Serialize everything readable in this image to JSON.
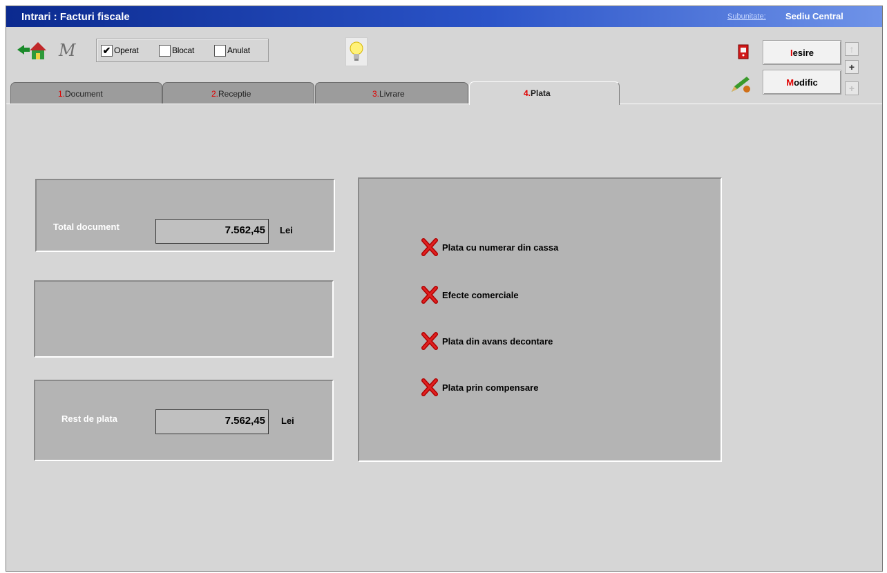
{
  "window": {
    "title": "Intrari : Facturi fiscale",
    "subunit_label": "Subunitate:",
    "subunit_value": "Sediu Central"
  },
  "status": {
    "operat": {
      "label": "Operat",
      "checked": true
    },
    "blocat": {
      "label": "Blocat",
      "checked": false
    },
    "anulat": {
      "label": "Anulat",
      "checked": false
    }
  },
  "buttons": {
    "iesire": {
      "hot": "I",
      "rest": "esire"
    },
    "modific": {
      "hot": "M",
      "rest": "odific"
    }
  },
  "tabs": [
    {
      "num": "1.",
      "label": "Document"
    },
    {
      "num": "2.",
      "label": "Receptie"
    },
    {
      "num": "3.",
      "label": "Livrare"
    },
    {
      "num": "4.",
      "label": "Plata"
    }
  ],
  "totals": {
    "total_label": "Total document",
    "total_value": "7.562,45",
    "rest_label": "Rest de plata",
    "rest_value": "7.562,45",
    "currency": "Lei"
  },
  "payments": [
    {
      "label": "Plata cu numerar din cassa",
      "icon": "red-x-icon"
    },
    {
      "label": "Efecte comerciale",
      "icon": "red-x-icon"
    },
    {
      "label": "Plata din avans decontare",
      "icon": "red-x-icon"
    },
    {
      "label": "Plata prin compensare",
      "icon": "red-x-icon"
    }
  ],
  "colors": {
    "accent_red": "#e00000",
    "title_blue": "#0b2a8f"
  }
}
